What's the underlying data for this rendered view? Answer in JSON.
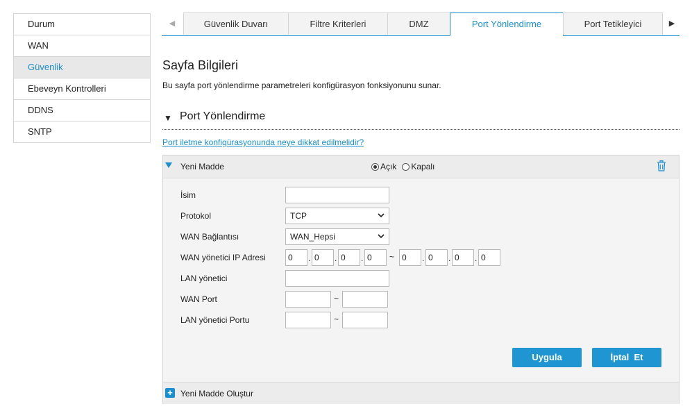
{
  "sidebar": {
    "items": [
      {
        "label": "Durum",
        "active": false
      },
      {
        "label": "WAN",
        "active": false
      },
      {
        "label": "Güvenlik",
        "active": true
      },
      {
        "label": "Ebeveyn Kontrolleri",
        "active": false
      },
      {
        "label": "DDNS",
        "active": false
      },
      {
        "label": "SNTP",
        "active": false
      }
    ]
  },
  "tabs": {
    "items": [
      {
        "label": "Güvenlik Duvarı"
      },
      {
        "label": "Filtre Kriterleri"
      },
      {
        "label": "DMZ"
      },
      {
        "label": "Port Yönlendirme"
      },
      {
        "label": "Port Tetikleyici"
      }
    ],
    "active_index": 3,
    "prev_glyph": "◀",
    "next_glyph": "▶"
  },
  "page": {
    "title": "Sayfa Bilgileri",
    "description": "Bu sayfa port yönlendirme parametreleri konfigürasyon fonksiyonunu sunar."
  },
  "section": {
    "title": "Port Yönlendirme",
    "toggle_glyph": "▼"
  },
  "help_link": "Port iletme konfigürasyonunda neye dikkat edilmelidir?",
  "entry": {
    "title": "Yeni Madde",
    "radio_on": "Açık",
    "radio_off": "Kapalı",
    "enabled": true
  },
  "form": {
    "name_label": "İsim",
    "name_value": "",
    "protocol_label": "Protokol",
    "protocol_value": "TCP",
    "wan_conn_label": "WAN Bağlantısı",
    "wan_conn_value": "WAN_Hepsi",
    "wan_ip_label": "WAN yönetici IP Adresi",
    "wan_ip_start": [
      "0",
      "0",
      "0",
      "0"
    ],
    "wan_ip_end": [
      "0",
      "0",
      "0",
      "0"
    ],
    "ip_dot": ".",
    "range_sep": "~",
    "lan_host_label": "LAN yönetici",
    "lan_host_value": "",
    "wan_port_label": "WAN Port",
    "wan_port_start": "",
    "wan_port_end": "",
    "lan_port_label": "LAN yönetici Portu",
    "lan_port_start": "",
    "lan_port_end": ""
  },
  "buttons": {
    "apply": "Uygula",
    "cancel": "İptal  Et"
  },
  "footer": {
    "add_glyph": "+",
    "add_label": "Yeni Madde Oluştur"
  },
  "colors": {
    "accent": "#1a8fd0",
    "button": "#1f95d2"
  }
}
